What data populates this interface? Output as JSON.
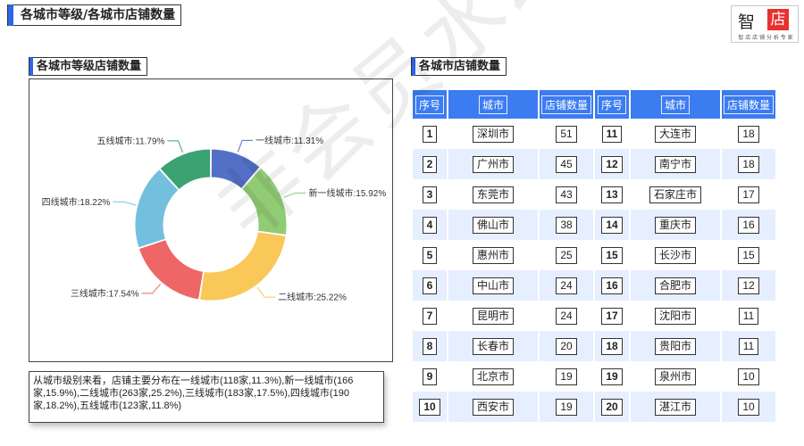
{
  "header": {
    "title": "各城市等级/各城市店铺数量",
    "logo_char1": "智",
    "logo_char2": "店",
    "logo_slogan": "智 店 店 铺 分 析 专 家"
  },
  "watermark": "非会员水印",
  "left_section": {
    "title": "各城市等级店铺数量",
    "note": "从城市级别来看，店铺主要分布在一线城市(118家,11.3%),新一线城市(166家,15.9%),二线城市(263家,25.2%),三线城市(183家,17.5%),四线城市(190家,18.2%),五线城市(123家,11.8%)"
  },
  "chart_data": {
    "type": "pie",
    "title": "各城市等级店铺数量",
    "donut": true,
    "labels": [
      "一线城市:11.31%",
      "新一线城市:15.92%",
      "二线城市:25.22%",
      "三线城市:17.54%",
      "四线城市:18.22%",
      "五线城市:11.79%"
    ],
    "categories": [
      "一线城市",
      "新一线城市",
      "二线城市",
      "三线城市",
      "四线城市",
      "五线城市"
    ],
    "values": [
      118,
      166,
      263,
      183,
      190,
      123
    ],
    "percentages": [
      11.31,
      15.92,
      25.22,
      17.54,
      18.22,
      11.79
    ],
    "colors": [
      "#5470c6",
      "#91cc75",
      "#fac858",
      "#ee6666",
      "#73c0de",
      "#3ba272"
    ]
  },
  "right_section": {
    "title": "各城市店铺数量",
    "headers": [
      "序号",
      "城市",
      "店铺数量",
      "序号",
      "城市",
      "店铺数量"
    ],
    "rows": [
      [
        "1",
        "深圳市",
        "51",
        "11",
        "大连市",
        "18"
      ],
      [
        "2",
        "广州市",
        "45",
        "12",
        "南宁市",
        "18"
      ],
      [
        "3",
        "东莞市",
        "43",
        "13",
        "石家庄市",
        "17"
      ],
      [
        "4",
        "佛山市",
        "38",
        "14",
        "重庆市",
        "16"
      ],
      [
        "5",
        "惠州市",
        "25",
        "15",
        "长沙市",
        "15"
      ],
      [
        "6",
        "中山市",
        "24",
        "16",
        "合肥市",
        "12"
      ],
      [
        "7",
        "昆明市",
        "24",
        "17",
        "沈阳市",
        "11"
      ],
      [
        "8",
        "长春市",
        "20",
        "18",
        "贵阳市",
        "11"
      ],
      [
        "9",
        "北京市",
        "19",
        "19",
        "泉州市",
        "10"
      ],
      [
        "10",
        "西安市",
        "19",
        "20",
        "湛江市",
        "10"
      ]
    ]
  }
}
